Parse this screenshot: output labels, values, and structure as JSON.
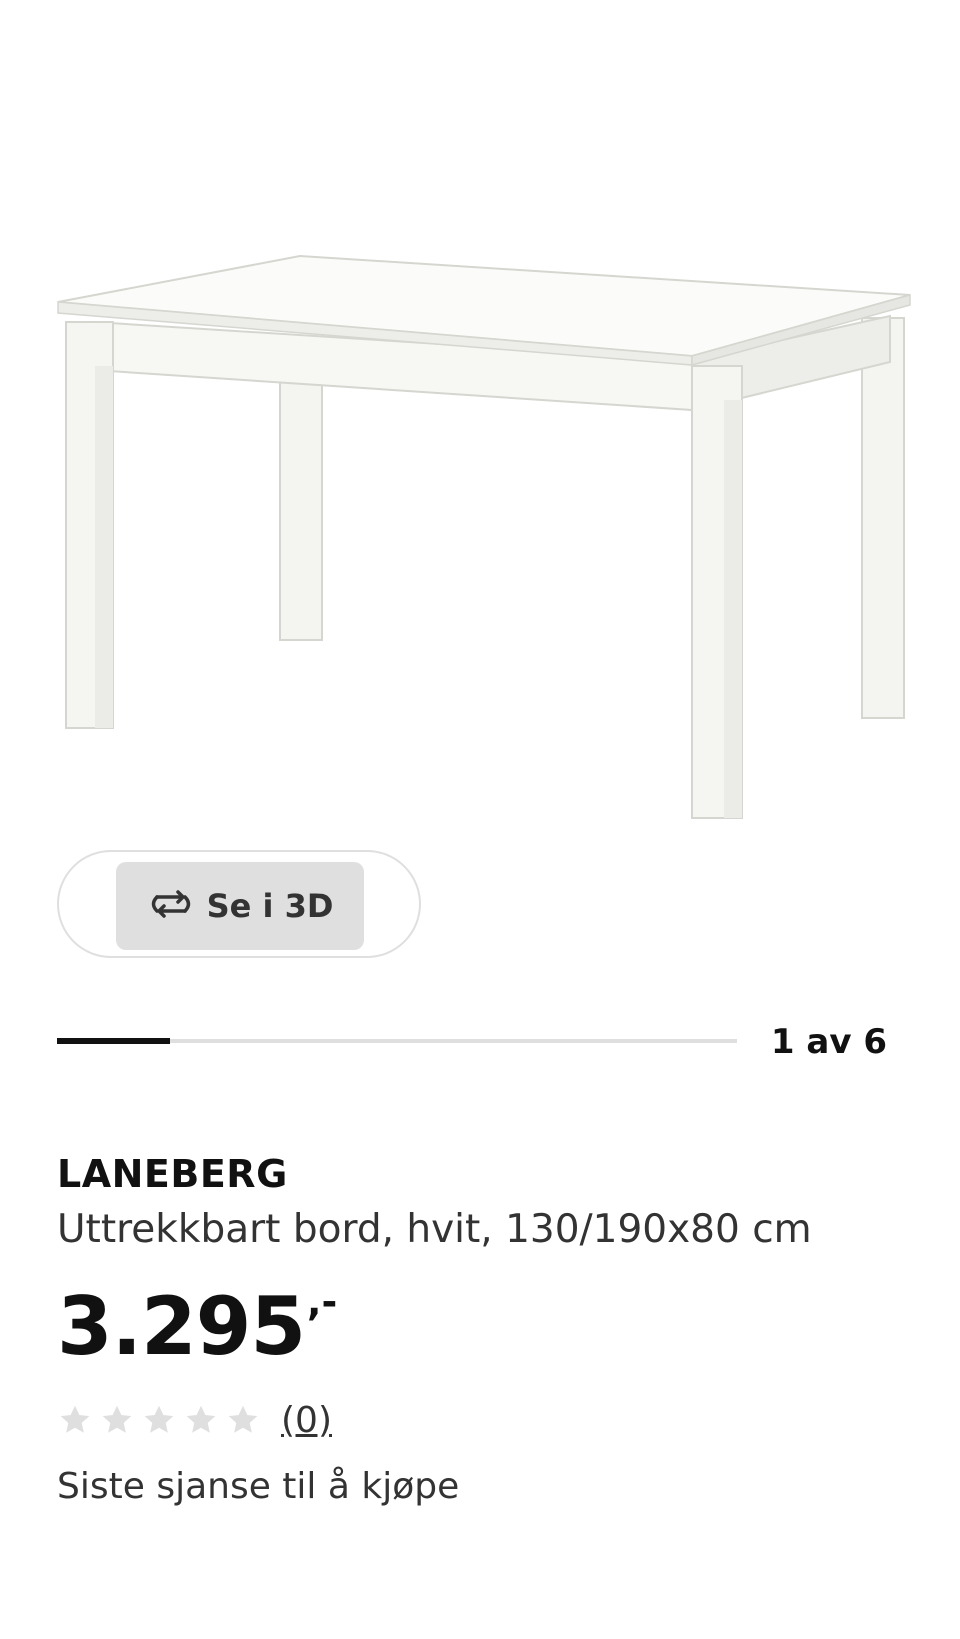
{
  "product_image": {
    "alt": "LANEBERG"
  },
  "view_3d": {
    "label": "Se i 3D",
    "icon": "rotate-3d-icon"
  },
  "carousel": {
    "counter": "1 av 6",
    "current": 1,
    "total": 6
  },
  "product": {
    "name": "LANEBERG",
    "description": "Uttrekkbart bord, hvit, 130/190x80 cm",
    "price": "3.295",
    "price_suffix": ",-",
    "rating": {
      "stars": 0,
      "max": 5,
      "count_label": "(0)"
    },
    "availability": "Siste sjanse til å kjøpe"
  },
  "colors": {
    "text": "#111111",
    "secondary_text": "#333333",
    "button_bg": "#dfdfdf",
    "star_inactive": "#dfdfdf"
  }
}
